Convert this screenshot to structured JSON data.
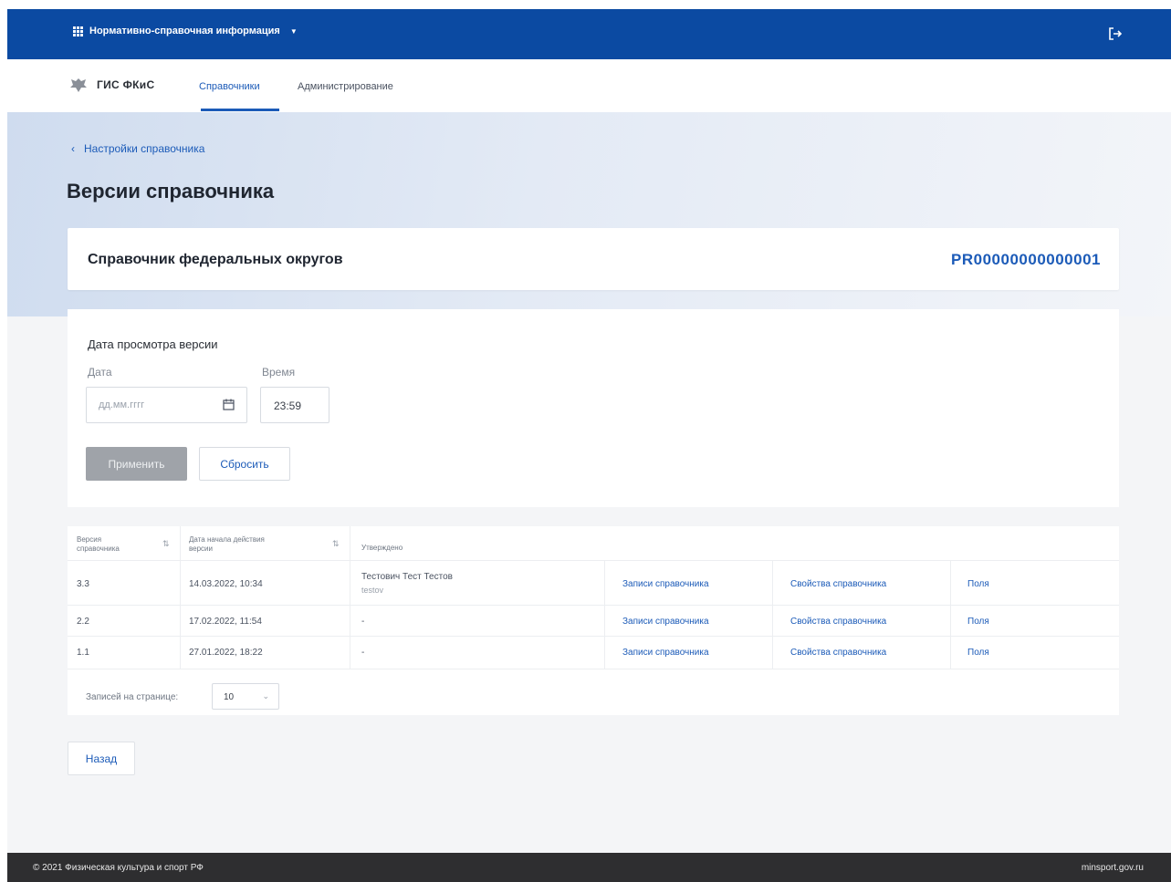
{
  "topbar": {
    "app_title": "Нормативно-справочная информация",
    "bg_color": "#0b4aa2"
  },
  "nav": {
    "brand": "ГИС ФКиС",
    "tabs": [
      "Справочники",
      "Администрирование"
    ],
    "active_tab": 0
  },
  "breadcrumb": {
    "back_label": "Настройки справочника"
  },
  "page": {
    "title": "Версии справочника"
  },
  "directory": {
    "name": "Справочник федеральных округов",
    "code": "PR00000000000001"
  },
  "filter": {
    "title": "Дата просмотра версии",
    "date_label": "Дата",
    "date_placeholder": "дд.мм.гггг",
    "time_label": "Время",
    "time_value": "23:59",
    "apply_label": "Применить",
    "reset_label": "Сбросить"
  },
  "table": {
    "headers": [
      "Версия справочника",
      "Дата начала действия версии",
      "Утверждено"
    ],
    "rows": [
      {
        "version": "3.3",
        "date": "14.03.2022, 10:34",
        "approved": "Тестович Тест Тестов",
        "approved_login": "testov",
        "records": "Записи справочника",
        "props": "Свойства справочника",
        "fields": "Поля"
      },
      {
        "version": "2.2",
        "date": "17.02.2022, 11:54",
        "approved": "-",
        "approved_login": "",
        "records": "Записи справочника",
        "props": "Свойства справочника",
        "fields": "Поля"
      },
      {
        "version": "1.1",
        "date": "27.01.2022, 18:22",
        "approved": "-",
        "approved_login": "",
        "records": "Записи справочника",
        "props": "Свойства справочника",
        "fields": "Поля"
      }
    ],
    "per_page_label": "Записей на странице:",
    "per_page_value": "10"
  },
  "back_button": "Назад",
  "footer": {
    "copyright": "© 2021 Физическая культура и спорт РФ",
    "site": "minsport.gov.ru"
  }
}
